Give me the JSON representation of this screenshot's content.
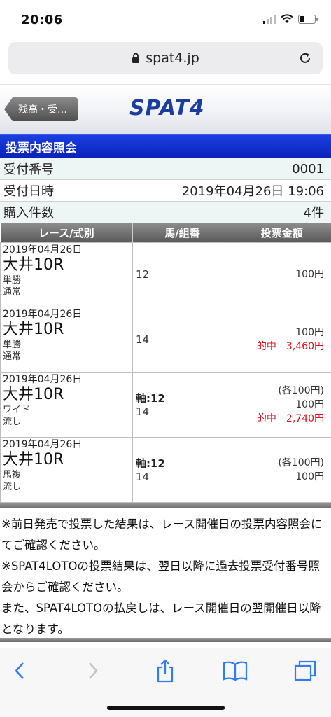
{
  "status_bar": {
    "time": "20:06"
  },
  "browser": {
    "url": "spat4.jp"
  },
  "site": {
    "back_label": "残高・受…",
    "logo": "SPAT4"
  },
  "section_title": "投票内容照会",
  "info": [
    {
      "label": "受付番号",
      "value": "0001"
    },
    {
      "label": "受付日時",
      "value": "2019年04月26日 19:06"
    },
    {
      "label": "購入件数",
      "value": "4件"
    }
  ],
  "table": {
    "headers": [
      "レース/式別",
      "馬/組番",
      "投票金額"
    ],
    "rows": [
      {
        "date": "2019年04月26日",
        "race": "大井10R",
        "type": "単勝",
        "method": "通常",
        "axis": "",
        "numbers": "12",
        "each": "",
        "amount": "100円",
        "hit": ""
      },
      {
        "date": "2019年04月26日",
        "race": "大井10R",
        "type": "単勝",
        "method": "通常",
        "axis": "",
        "numbers": "14",
        "each": "",
        "amount": "100円",
        "hit": "的中　3,460円"
      },
      {
        "date": "2019年04月26日",
        "race": "大井10R",
        "type": "ワイド",
        "method": "流し",
        "axis": "軸:12",
        "numbers": "14",
        "each": "(各100円)",
        "amount": "100円",
        "hit": "的中　2,740円"
      },
      {
        "date": "2019年04月26日",
        "race": "大井10R",
        "type": "馬複",
        "method": "流し",
        "axis": "軸:12",
        "numbers": "14",
        "each": "(各100円)",
        "amount": "100円",
        "hit": ""
      }
    ]
  },
  "notes": [
    "※前日発売で投票した結果は、レース開催日の投票内容照会にてご確認ください。",
    "※SPAT4LOTOの投票結果は、翌日以降に過去投票受付番号照会からご確認ください。",
    "また、SPAT4LOTOの払戻しは、レース開催日の翌開催日以降となります。"
  ],
  "colors": {
    "header_blue": "#0a22b8",
    "hit_red": "#e0141e",
    "ios_blue": "#2f7cf6"
  }
}
